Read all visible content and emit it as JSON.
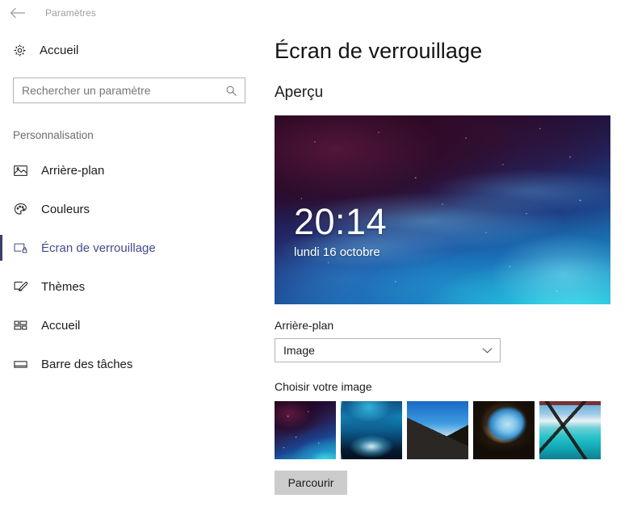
{
  "titlebar": {
    "back_icon": "back-arrow-icon",
    "title": "Paramètres"
  },
  "sidebar": {
    "home": {
      "label": "Accueil",
      "icon": "gear-icon"
    },
    "search": {
      "placeholder": "Rechercher un paramètre",
      "value": "",
      "icon": "search-icon"
    },
    "group_title": "Personnalisation",
    "items": [
      {
        "label": "Arrière-plan",
        "icon": "picture-icon",
        "selected": false
      },
      {
        "label": "Couleurs",
        "icon": "palette-icon",
        "selected": false
      },
      {
        "label": "Écran de verrouillage",
        "icon": "lock-screen-icon",
        "selected": true
      },
      {
        "label": "Thèmes",
        "icon": "theme-brush-icon",
        "selected": false
      },
      {
        "label": "Accueil",
        "icon": "start-tiles-icon",
        "selected": false
      },
      {
        "label": "Barre des tâches",
        "icon": "taskbar-icon",
        "selected": false
      }
    ],
    "accent_color": "#3b4068",
    "selected_text_color": "#444b8c"
  },
  "main": {
    "page_title": "Écran de verrouillage",
    "preview_section_title": "Aperçu",
    "preview": {
      "time": "20:14",
      "date": "lundi 16 octobre",
      "wallpaper_name": "nebula-wallpaper"
    },
    "background_field": {
      "label": "Arrière-plan",
      "value": "Image",
      "chevron_icon": "chevron-down-icon"
    },
    "chooser": {
      "label": "Choisir votre image",
      "thumbnails": [
        {
          "name": "nebula-thumbnail",
          "selected": true
        },
        {
          "name": "ice-cave-thumbnail",
          "selected": false
        },
        {
          "name": "volcanic-ridge-thumbnail",
          "selected": false
        },
        {
          "name": "sea-cave-arch-thumbnail",
          "selected": false
        },
        {
          "name": "turquoise-lagoon-thumbnail",
          "selected": false
        }
      ]
    },
    "browse_button": "Parcourir"
  }
}
